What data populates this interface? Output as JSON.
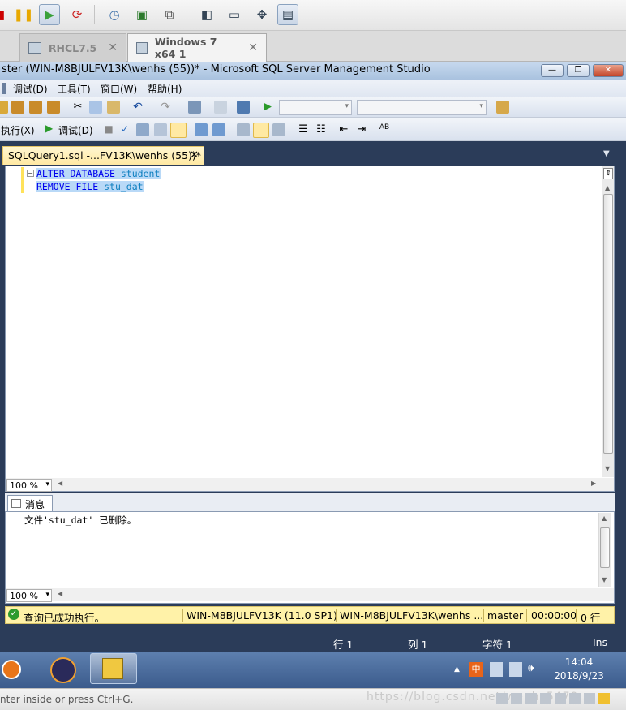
{
  "vmware": {
    "tabs": [
      {
        "label": "RHCL7.5"
      },
      {
        "label": "Windows 7 x64 1"
      }
    ],
    "close_glyph": "✕",
    "status_hint": "nter inside or press Ctrl+G.",
    "watermark": "https://blog.csdn.net/wenhs5479"
  },
  "window": {
    "title": "ster (WIN-M8BJULFV13K\\wenhs (55))* - Microsoft SQL Server Management Studio",
    "minimize": "—",
    "maximize": "❐",
    "close": "✕"
  },
  "menu": {
    "items": [
      "调试(D)",
      "工具(T)",
      "窗口(W)",
      "帮助(H)"
    ]
  },
  "toolbar2": {
    "execute_label": "执行(X)",
    "debug_label": "调试(D)"
  },
  "document": {
    "tab_label": "SQLQuery1.sql -...FV13K\\wenhs (55))*",
    "tab_close": "✕",
    "lines": [
      {
        "kw": "ALTER DATABASE",
        "id": "student"
      },
      {
        "kw": "REMOVE FILE",
        "id": "stu_dat"
      }
    ],
    "zoom": "100 %"
  },
  "messages": {
    "tab_label": "消息",
    "text": "文件'stu_dat' 已删除。",
    "zoom": "100 %"
  },
  "query_status": {
    "message": "查询已成功执行。",
    "server": "WIN-M8BJULFV13K (11.0 SP1)",
    "user": "WIN-M8BJULFV13K\\wenhs ...",
    "database": "master",
    "time": "00:00:00",
    "rows": "0 行"
  },
  "editor_status": {
    "line": "行 1",
    "col": "列 1",
    "ch": "字符 1",
    "mode": "Ins"
  },
  "clock": {
    "time": "14:04",
    "date": "2018/9/23"
  },
  "colors": {
    "accent": "#2b3c59",
    "status_yellow": "#fff2a8",
    "tab_yellow": "#ffe9a3",
    "selection": "#b9d9f7"
  }
}
